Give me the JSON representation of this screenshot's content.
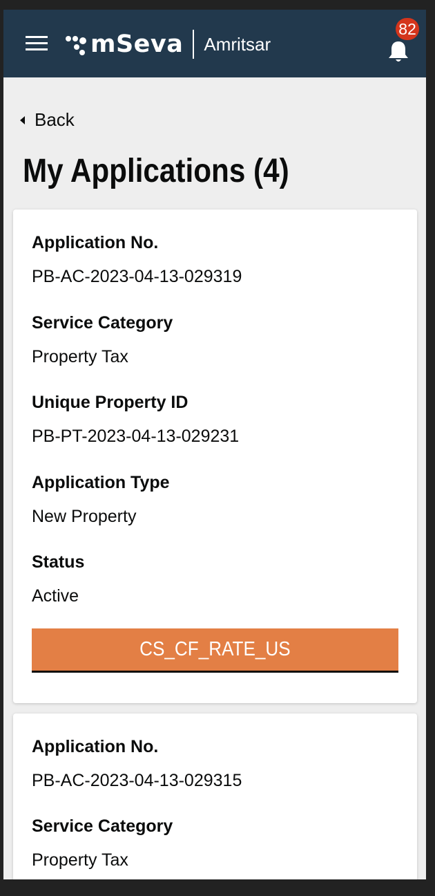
{
  "header": {
    "menu_icon": "hamburger-menu-icon",
    "logo_text": "mSeva",
    "city": "Amritsar",
    "notification_icon": "bell-icon",
    "notification_count": "82",
    "colors": {
      "header_bg": "#22394d",
      "badge_bg": "#d4351c",
      "accent": "#e37f45"
    }
  },
  "back": {
    "icon": "caret-left-icon",
    "label": "Back"
  },
  "page": {
    "title": "My Applications (4)"
  },
  "applications": [
    {
      "application_no_label": "Application No.",
      "application_no": "PB-AC-2023-04-13-029319",
      "service_category_label": "Service Category",
      "service_category": "Property Tax",
      "property_id_label": "Unique Property ID",
      "property_id": "PB-PT-2023-04-13-029231",
      "application_type_label": "Application Type",
      "application_type": "New Property",
      "status_label": "Status",
      "status": "Active",
      "rate_button_label": "CS_CF_RATE_US"
    },
    {
      "application_no_label": "Application No.",
      "application_no": "PB-AC-2023-04-13-029315",
      "service_category_label": "Service Category",
      "service_category": "Property Tax"
    }
  ]
}
